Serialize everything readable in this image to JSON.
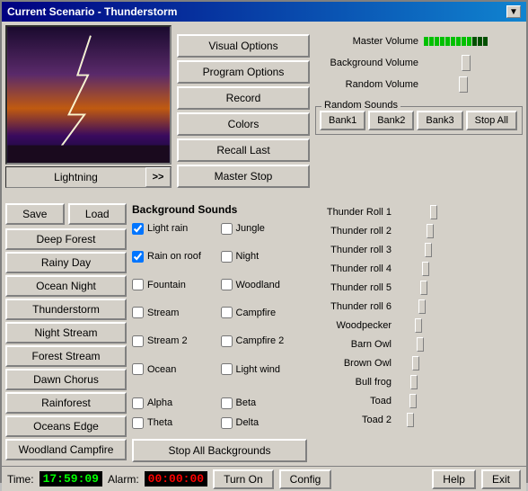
{
  "window": {
    "title": "Current Scenario - Thunderstorm",
    "close_btn": "▼"
  },
  "preview": {
    "label": "Lightning",
    "arrow_btn": ">>"
  },
  "mid_buttons": {
    "visual_options": "Visual Options",
    "program_options": "Program Options",
    "record": "Record",
    "colors": "Colors",
    "recall_last": "Recall Last",
    "master_stop": "Master Stop"
  },
  "volume": {
    "master_label": "Master Volume",
    "background_label": "Background Volume",
    "random_label": "Random Volume",
    "master_value": 75,
    "background_value": 60,
    "random_value": 55
  },
  "random_sounds_header": {
    "label": "Random Sounds",
    "bank1": "Bank1",
    "bank2": "Bank2",
    "bank3": "Bank3",
    "stop_all": "Stop All"
  },
  "save_load": {
    "save": "Save",
    "load": "Load"
  },
  "scenarios": [
    {
      "label": "Deep Forest",
      "active": false
    },
    {
      "label": "Rainy Day",
      "active": false
    },
    {
      "label": "Ocean Night",
      "active": false
    },
    {
      "label": "Thunderstorm",
      "active": false
    },
    {
      "label": "Night Stream",
      "active": false
    },
    {
      "label": "Forest Stream",
      "active": false
    },
    {
      "label": "Dawn Chorus",
      "active": false
    },
    {
      "label": "Rainforest",
      "active": false
    },
    {
      "label": "Oceans Edge",
      "active": false
    },
    {
      "label": "Woodland Campfire",
      "active": false
    }
  ],
  "bg_sounds": {
    "title": "Background Sounds",
    "sounds_col1": [
      {
        "label": "Light rain",
        "checked": true
      },
      {
        "label": "Rain on roof",
        "checked": true
      },
      {
        "label": "Fountain",
        "checked": false
      },
      {
        "label": "Stream",
        "checked": false
      },
      {
        "label": "Stream 2",
        "checked": false
      },
      {
        "label": "Ocean",
        "checked": false
      }
    ],
    "sounds_col2": [
      {
        "label": "Jungle",
        "checked": false
      },
      {
        "label": "Night",
        "checked": false
      },
      {
        "label": "Woodland",
        "checked": false
      },
      {
        "label": "Campfire",
        "checked": false
      },
      {
        "label": "Campfire 2",
        "checked": false
      },
      {
        "label": "Light wind",
        "checked": false
      }
    ],
    "greek_col1": [
      {
        "label": "Alpha",
        "checked": false
      },
      {
        "label": "Theta",
        "checked": false
      }
    ],
    "greek_col2": [
      {
        "label": "Beta",
        "checked": false
      },
      {
        "label": "Delta",
        "checked": false
      }
    ],
    "stop_all_btn": "Stop All Backgrounds"
  },
  "random_sounds_list": [
    {
      "label": "Thunder Roll 1",
      "value": 45
    },
    {
      "label": "Thunder roll 2",
      "value": 40
    },
    {
      "label": "Thunder roll 3",
      "value": 38
    },
    {
      "label": "Thunder roll 4",
      "value": 35
    },
    {
      "label": "Thunder roll 5",
      "value": 32
    },
    {
      "label": "Thunder roll 6",
      "value": 30
    },
    {
      "label": "Woodpecker",
      "value": 25
    },
    {
      "label": "Barn Owl",
      "value": 28
    },
    {
      "label": "Brown Owl",
      "value": 22
    },
    {
      "label": "Bull frog",
      "value": 20
    },
    {
      "label": "Toad",
      "value": 18
    },
    {
      "label": "Toad 2",
      "value": 15
    }
  ],
  "status_bar": {
    "time_label": "Time:",
    "time_value": "17:59:09",
    "alarm_label": "Alarm:",
    "alarm_value": "00:00:00",
    "turn_on_btn": "Turn On",
    "config_btn": "Config",
    "help_btn": "Help",
    "exit_btn": "Exit"
  }
}
